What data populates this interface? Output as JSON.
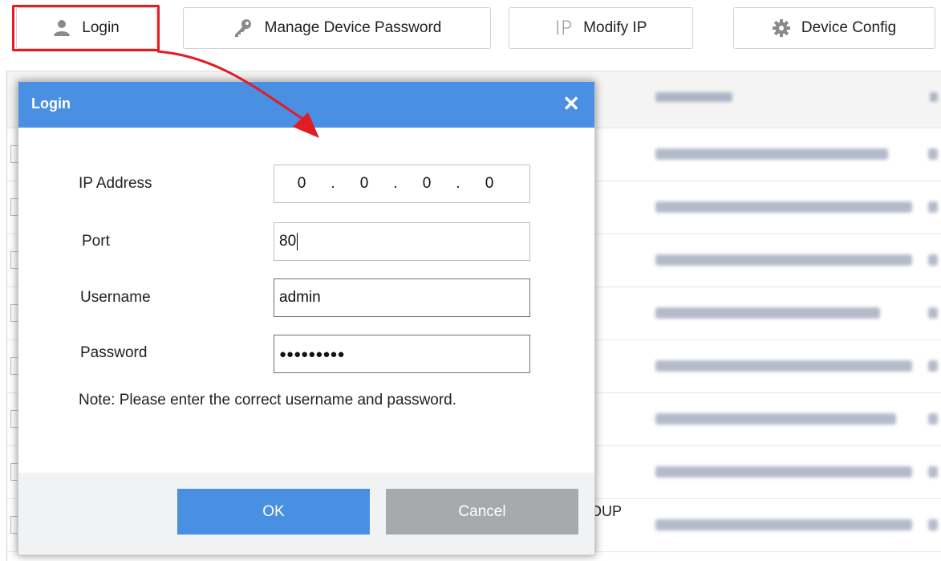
{
  "toolbar": {
    "login_label": "Login",
    "login_icon": "user-icon",
    "manage_password_label": "Manage Device Password",
    "manage_password_icon": "key-icon",
    "modify_ip_label": "Modify IP",
    "modify_ip_icon": "ip-icon",
    "modify_ip_icon_text": "IP",
    "device_config_label": "Device Config",
    "device_config_icon": "gear-icon"
  },
  "annotation": {
    "highlight_color": "#e31b23"
  },
  "background_table": {
    "visible_text": "DUP"
  },
  "dialog": {
    "title": "Login",
    "close_symbol": "✕",
    "header_color": "#4a90e2",
    "fields": {
      "ip_label": "IP Address",
      "ip_octets": [
        "0",
        "0",
        "0",
        "0"
      ],
      "ip_separator": ".",
      "port_label": "Port",
      "port_value": "80",
      "username_label": "Username",
      "username_value": "admin",
      "password_label": "Password",
      "password_value": "●●●●●●●●●"
    },
    "note": "Note: Please enter the correct username and password.",
    "ok_label": "OK",
    "cancel_label": "Cancel"
  }
}
